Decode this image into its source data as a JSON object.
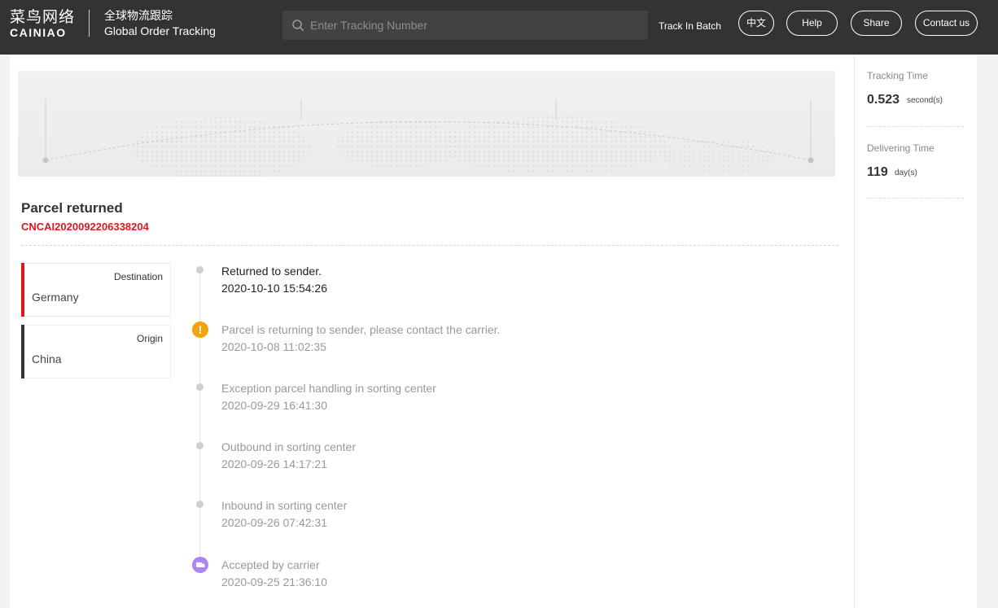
{
  "header": {
    "logo_cn": "菜鸟网络",
    "logo_en": "CAINIAO",
    "product_cn": "全球物流跟踪",
    "product_en": "Global Order Tracking",
    "search_placeholder": "Enter Tracking Number",
    "batch_label": "Track In Batch",
    "buttons": {
      "lang": "中文",
      "help": "Help",
      "share": "Share",
      "contact": "Contact us"
    }
  },
  "parcel": {
    "status": "Parcel returned",
    "tracking_number": "CNCAI2020092206338204"
  },
  "locations": [
    {
      "type": "Destination",
      "place": "Germany",
      "color": "#e0161d"
    },
    {
      "type": "Origin",
      "place": "China",
      "color": "#333333"
    }
  ],
  "events": [
    {
      "desc": "Returned to sender.",
      "time": "2020-10-10 15:54:26",
      "icon": "dot"
    },
    {
      "desc": "Parcel is returning to sender, please contact the carrier.",
      "time": "2020-10-08 11:02:35",
      "icon": "warning-icon"
    },
    {
      "desc": "Exception parcel handling in sorting center",
      "time": "2020-09-29 16:41:30",
      "icon": "dot"
    },
    {
      "desc": "Outbound in sorting center",
      "time": "2020-09-26 14:17:21",
      "icon": "dot"
    },
    {
      "desc": "Inbound in sorting center",
      "time": "2020-09-26 07:42:31",
      "icon": "dot"
    },
    {
      "desc": "Accepted by carrier",
      "time": "2020-09-25 21:36:10",
      "icon": "truck-icon"
    }
  ],
  "stats": {
    "tracking_time": {
      "label": "Tracking Time",
      "value": "0.523",
      "unit": "second(s)"
    },
    "delivering_time": {
      "label": "Delivering Time",
      "value": "119",
      "unit": "day(s)"
    }
  },
  "colors": {
    "header_bg": "#333333",
    "accent_red": "#e0161d",
    "warning": "#f0a30a",
    "carrier": "#a987ef"
  }
}
